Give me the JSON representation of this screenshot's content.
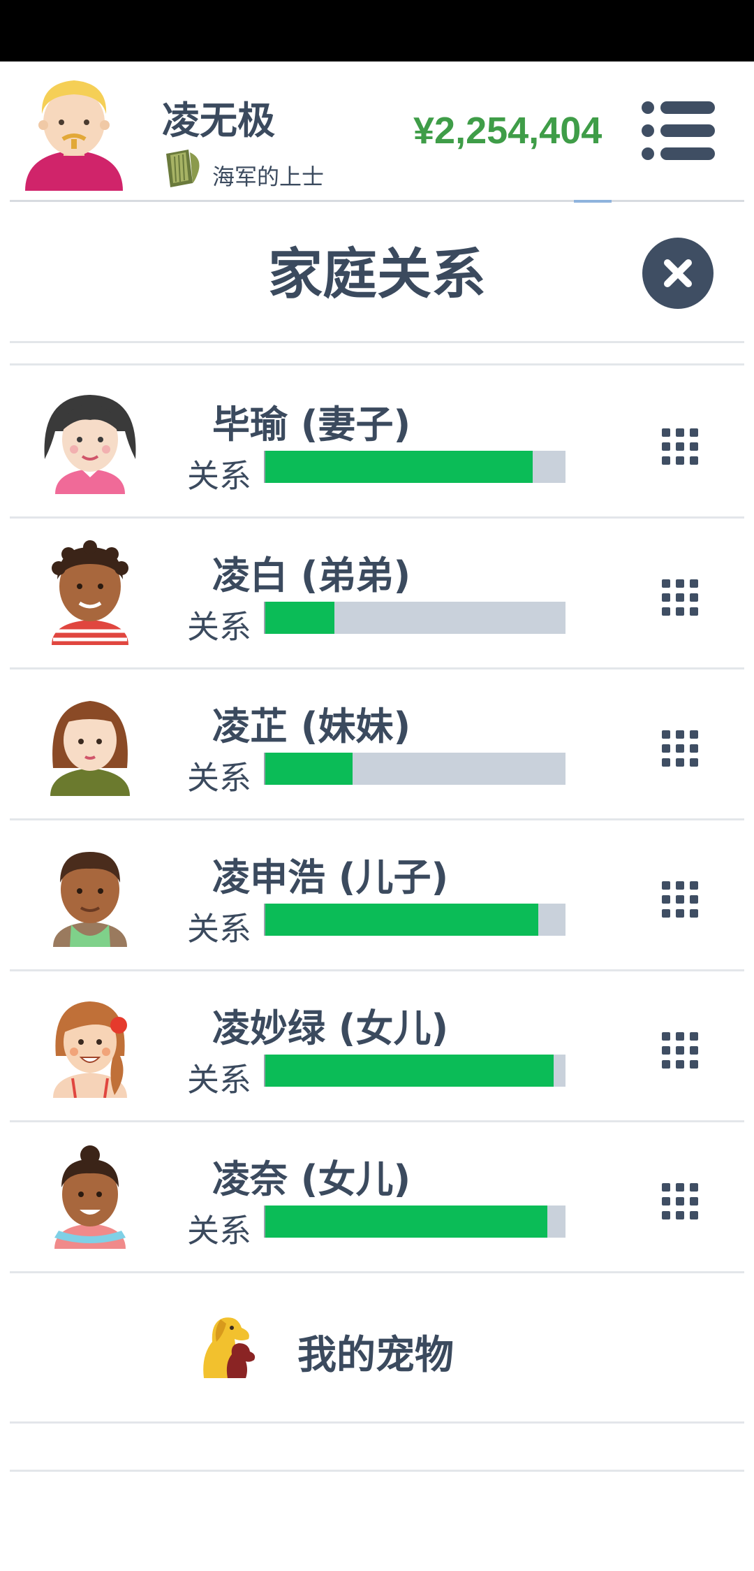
{
  "player": {
    "name": "凌无极",
    "rank": "海军的上士",
    "money": "¥2,254,404"
  },
  "dialog": {
    "title": "家庭关系"
  },
  "relation_label": "关系",
  "family": [
    {
      "name": "毕瑜 (妻子)",
      "relationship": 0.89,
      "avatar": "wife-avatar"
    },
    {
      "name": "凌白 (弟弟)",
      "relationship": 0.23,
      "avatar": "brother-avatar"
    },
    {
      "name": "凌芷 (妹妹)",
      "relationship": 0.29,
      "avatar": "sister-avatar"
    },
    {
      "name": "凌申浩 (儿子)",
      "relationship": 0.91,
      "avatar": "son-avatar"
    },
    {
      "name": "凌妙绿 (女儿)",
      "relationship": 0.96,
      "avatar": "daughter-avatar"
    },
    {
      "name": "凌奈 (女儿)",
      "relationship": 0.94,
      "avatar": "daughter-avatar"
    }
  ],
  "pets": {
    "label": "我的宠物"
  },
  "colors": {
    "money": "#3f9d48",
    "bar_fill": "#0bbc57",
    "bar_track": "#c9d1db",
    "text": "#3b4a5e"
  }
}
